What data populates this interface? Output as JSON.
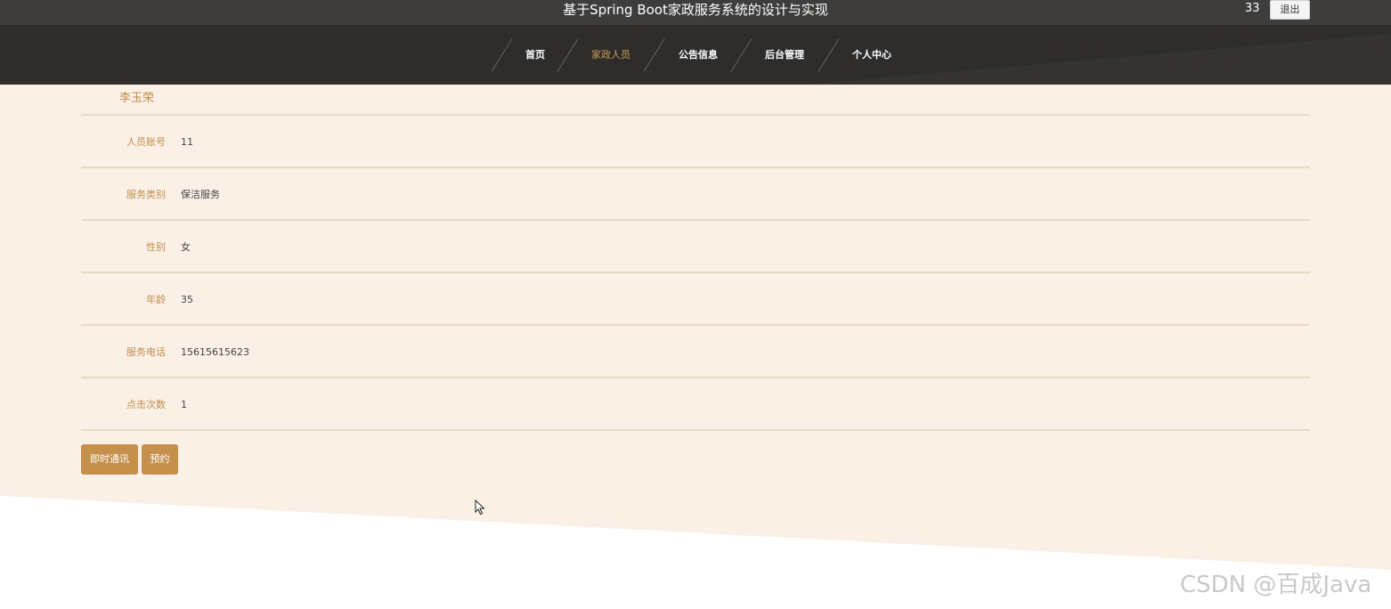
{
  "header": {
    "site_title": "基于Spring Boot家政服务系统的设计与实现",
    "user_name": "33",
    "logout_label": "退出"
  },
  "nav": {
    "items": [
      {
        "label": "首页",
        "active": false
      },
      {
        "label": "家政人员",
        "active": true
      },
      {
        "label": "公告信息",
        "active": false
      },
      {
        "label": "后台管理",
        "active": false
      },
      {
        "label": "个人中心",
        "active": false
      }
    ]
  },
  "detail": {
    "name": "李玉荣",
    "fields": [
      {
        "label": "人员账号",
        "value": "11"
      },
      {
        "label": "服务类别",
        "value": "保洁服务"
      },
      {
        "label": "性别",
        "value": "女"
      },
      {
        "label": "年龄",
        "value": "35"
      },
      {
        "label": "服务电话",
        "value": "15615615623"
      },
      {
        "label": "点击次数",
        "value": "1"
      }
    ]
  },
  "actions": {
    "chat_label": "即时通讯",
    "book_label": "预约"
  },
  "watermark": "CSDN @百成Java",
  "colors": {
    "accent": "#c4904c",
    "nav_bg": "#2e2d2b",
    "topbar_bg": "#3e3d3b",
    "content_bg": "#faf0e6",
    "divider": "#ead9c5"
  },
  "icons": [
    "mouse-pointer-icon"
  ]
}
